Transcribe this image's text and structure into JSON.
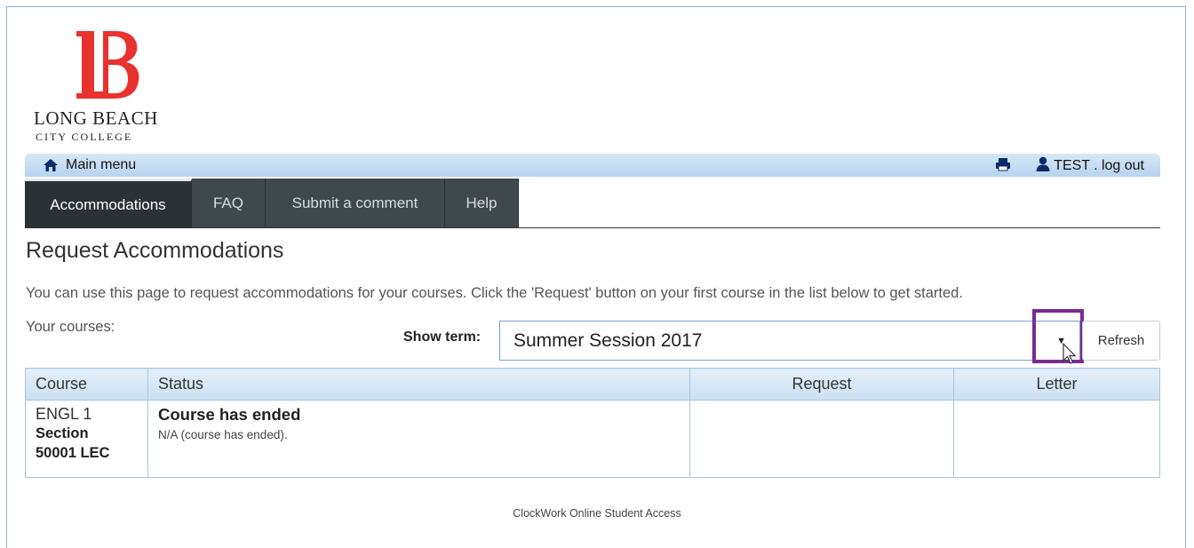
{
  "logo": {
    "line1": "LONG BEACH",
    "line2": "CITY COLLEGE",
    "color": "#e8322f"
  },
  "topbar": {
    "main_menu": "Main menu",
    "user": "TEST",
    "logout": ". log out"
  },
  "tabs": [
    {
      "label": "Accommodations",
      "active": true
    },
    {
      "label": "FAQ",
      "active": false
    },
    {
      "label": "Submit a comment",
      "active": false
    },
    {
      "label": "Help",
      "active": false
    }
  ],
  "page": {
    "title": "Request Accommodations",
    "intro": "You can use this page to request accommodations for your courses. Click the 'Request' button on your first course in the list below to get started.",
    "your_courses": "Your courses:",
    "show_term_label": "Show term:",
    "term_value": "Summer Session 2017",
    "refresh_label": "Refresh"
  },
  "table": {
    "headers": [
      "Course",
      "Status",
      "Request",
      "Letter"
    ],
    "rows": [
      {
        "course": "ENGL 1",
        "section_line1": "Section",
        "section_line2": "50001 LEC",
        "status_title": "Course has ended",
        "status_sub": "N/A (course has ended).",
        "request": "",
        "letter": ""
      }
    ]
  },
  "footer": "ClockWork Online Student Access",
  "colors": {
    "highlight": "#7b2a8e",
    "tab_bg": "#3f484d",
    "accent": "#8fb0d0"
  }
}
